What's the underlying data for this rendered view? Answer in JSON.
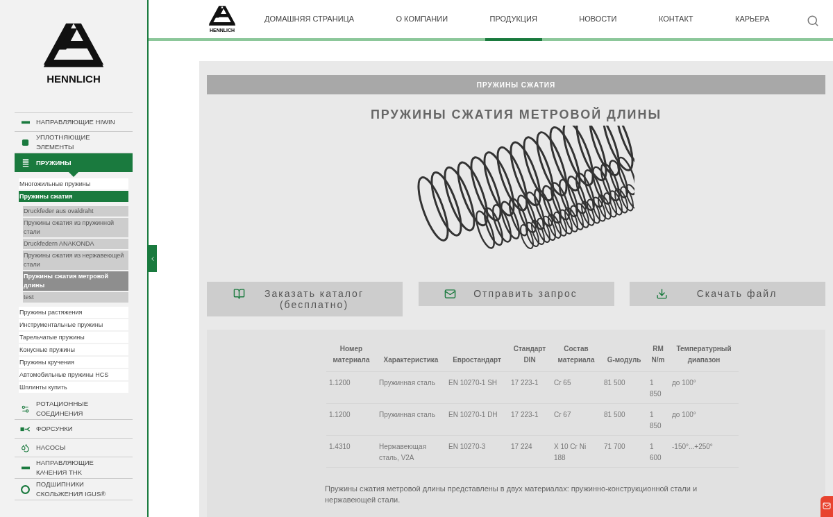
{
  "sidebar": {
    "logo_text": "HENNLICH",
    "categories": [
      {
        "label": "НАПРАВЛЯЮЩИЕ HIWIN",
        "selected": false
      },
      {
        "label": "УПЛОТНЯЮЩИЕ ЭЛЕМЕНТЫ",
        "selected": false
      },
      {
        "label": "ПРУЖИНЫ",
        "selected": true,
        "children": [
          {
            "label": "Многожильные пружины",
            "selected": false
          },
          {
            "label": "Пружины сжатия",
            "selected": true,
            "children": [
              {
                "label": "Druckfeder aus ovaldraht",
                "selected": false
              },
              {
                "label": "Пружины сжатия из пружинной стали",
                "selected": false
              },
              {
                "label": "Druckfedern ANAKONDA",
                "selected": false
              },
              {
                "label": "Пружины сжатия из нержавеющей стали",
                "selected": false
              },
              {
                "label": "Пружины сжатия метровой длины",
                "selected": true
              },
              {
                "label": "test",
                "selected": false
              }
            ]
          },
          {
            "label": "Пружины растяжения",
            "selected": false
          },
          {
            "label": "Инструментальные пружины",
            "selected": false
          },
          {
            "label": "Тарельчатые пружины",
            "selected": false
          },
          {
            "label": "Конусные пружины",
            "selected": false
          },
          {
            "label": "Пружины кручения",
            "selected": false
          },
          {
            "label": "Автомобильные пружины HCS",
            "selected": false
          },
          {
            "label": "Шплинты купить",
            "selected": false
          }
        ]
      },
      {
        "label": "РОТАЦИОННЫЕ СОЕДИНЕНИЯ",
        "selected": false
      },
      {
        "label": "ФОРСУНКИ",
        "selected": false
      },
      {
        "label": "НАСОСЫ",
        "selected": false
      },
      {
        "label": "НАПРАВЛЯЮЩИЕ КАЧЕНИЯ THK",
        "selected": false
      },
      {
        "label": "ПОДШИПНИКИ СКОЛЬЖЕНИЯ IGUS®",
        "selected": false
      }
    ]
  },
  "header": {
    "logo_text": "HENNLICH",
    "nav": [
      {
        "label": "ДОМАШНЯЯ СТРАНИЦА",
        "selected": false
      },
      {
        "label": "О КОМПАНИИ",
        "selected": false
      },
      {
        "label": "ПРОДУКЦИЯ",
        "selected": true
      },
      {
        "label": "НОВОСТИ",
        "selected": false
      },
      {
        "label": "КОНТАКТ",
        "selected": false
      },
      {
        "label": "КАРЬЕРА",
        "selected": false
      }
    ]
  },
  "content": {
    "band": "ПРУЖИНЫ СЖАТИЯ",
    "title": "ПРУЖИНЫ СЖАТИЯ МЕТРОВОЙ ДЛИНЫ",
    "buttons": [
      {
        "label": "Заказать каталог (бесплатно)"
      },
      {
        "label": "Отправить запрос"
      },
      {
        "label": "Скачать файл"
      }
    ],
    "table": {
      "columns": [
        "Номер материала",
        "Характеристика",
        "Евростандарт",
        "Стандарт DIN",
        "Состав материала",
        "G-модуль",
        "RM N/m",
        "Температурный диапазон"
      ],
      "rows": [
        [
          "1.1200",
          "Пружинная сталь",
          "EN 10270-1 SH",
          "17 223-1",
          "Cr 65",
          "81 500",
          "1 850",
          "до 100°"
        ],
        [
          "1.1200",
          "Пружинная сталь",
          "EN 10270-1 DH",
          "17 223-1",
          "Cr 67",
          "81 500",
          "1 850",
          "до 100°"
        ],
        [
          "1.4310",
          "Нержавеющая сталь, V2A",
          "EN 10270-3",
          "17 224",
          "X 10 Cr Ni 188",
          "71 700",
          "1 600",
          "-150°...+250°"
        ]
      ]
    },
    "description": "Пружины сжатия метровой длины представлены в двух материалах: пружинно-конструкционной стали и нержавеющей стали."
  }
}
